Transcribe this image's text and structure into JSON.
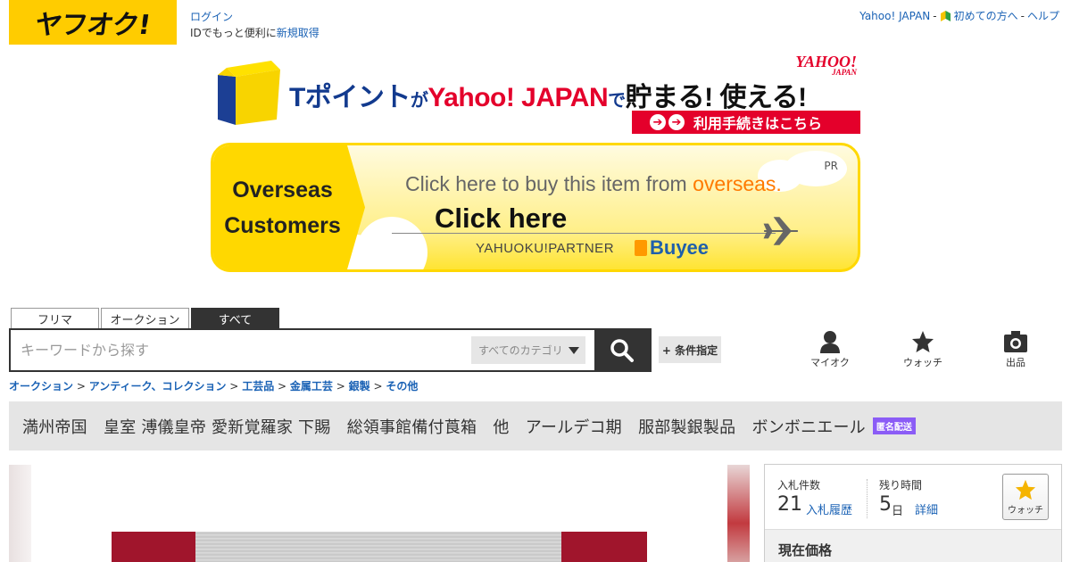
{
  "header": {
    "logo_text": "ヤフオク!",
    "login_label": "ログイン",
    "id_prompt": "IDでもっと便利に",
    "signup_label": "新規取得",
    "yahoo_japan_label": "Yahoo! JAPAN",
    "first_time_label": "初めての方へ",
    "help_label": "ヘルプ",
    "separator": "-"
  },
  "tpoint_banner": {
    "t_text": "Tポイント",
    "ga": "が",
    "yahoo_japan": "Yahoo! JAPAN",
    "de": "で",
    "tamaru": "貯まる! 使える!",
    "yahoo_logo": "YAHOO!",
    "yahoo_logo_sub": "JAPAN",
    "cta": "利用手続きはこちら",
    "t_glyph": "T"
  },
  "overseas_banner": {
    "left_line1": "Overseas",
    "left_line2": "Customers",
    "top_text": "Click here to buy this item from ",
    "top_highlight": "overseas.",
    "click_here": "Click here",
    "partner": "YAHUOKU!PARTNER",
    "buyee": "Buyee",
    "pr": "PR"
  },
  "search": {
    "tabs": [
      "フリマ",
      "オークション",
      "すべて"
    ],
    "placeholder": "キーワードから探す",
    "category": "すべてのカテゴリ",
    "condition_button": "+ 条件指定"
  },
  "nav": {
    "my_auction": "マイオク",
    "watch": "ウォッチ",
    "sell": "出品"
  },
  "breadcrumb": [
    "オークション",
    "アンティーク、コレクション",
    "工芸品",
    "金属工芸",
    "銀製",
    "その他"
  ],
  "breadcrumb_sep": ">",
  "item": {
    "title": "満州帝国　皇室 溥儀皇帝 愛新覚羅家 下賜　総領事館備付莨箱　他　アールデコ期　服部製銀製品　ボンボニエール",
    "badge": "匿名配送"
  },
  "side_panel": {
    "bids_label": "入札件数",
    "bids_count": "21",
    "bid_history": "入札履歴",
    "time_label": "残り時間",
    "time_value": "5",
    "time_unit": "日",
    "detail": "詳細",
    "watch": "ウォッチ",
    "current_price": "現在価格"
  },
  "colors": {
    "brand_yellow": "#ffcc00",
    "link_blue": "#1a62b5",
    "dark": "#333333",
    "tpoint_red": "#e4002b",
    "tpoint_blue": "#123a8e",
    "badge_purple": "#8b5cf6"
  }
}
